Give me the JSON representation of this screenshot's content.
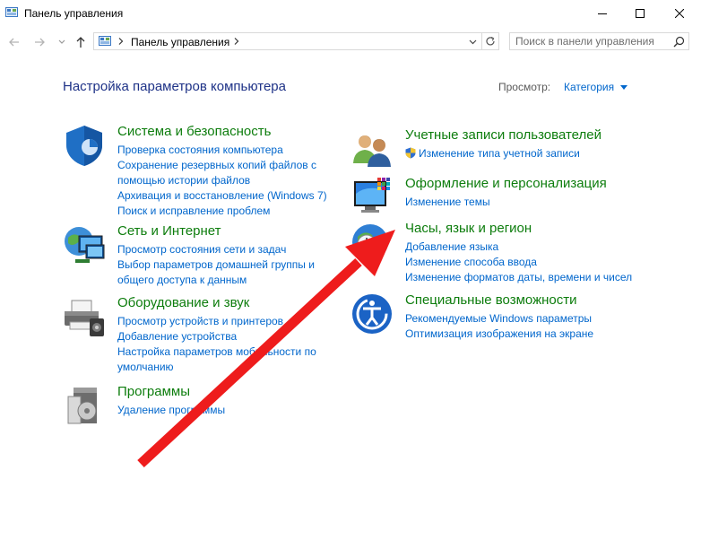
{
  "window": {
    "title": "Панель управления"
  },
  "nav": {
    "breadcrumb": "Панель управления",
    "search_placeholder": "Поиск в панели управления"
  },
  "header": {
    "heading": "Настройка параметров компьютера",
    "view_label": "Просмотр:",
    "view_value": "Категория"
  },
  "categories": [
    {
      "title": "Система и безопасность",
      "links": [
        "Проверка состояния компьютера",
        "Сохранение резервных копий файлов с",
        "помощью истории файлов",
        "Архивация и восстановление (Windows 7)",
        "Поиск и исправление проблем"
      ]
    },
    {
      "title": "Сеть и Интернет",
      "links": [
        "Просмотр состояния сети и задач",
        "Выбор параметров домашней группы и",
        "общего доступа к данным"
      ]
    },
    {
      "title": "Оборудование и звук",
      "links": [
        "Просмотр устройств и принтеров",
        "Добавление устройства",
        "Настройка параметров мобильности по",
        "умолчанию"
      ]
    },
    {
      "title": "Программы",
      "links": [
        "Удаление программы"
      ]
    },
    {
      "title": "Учетные записи пользователей",
      "links": [
        "Изменение типа учетной записи"
      ]
    },
    {
      "title": "Оформление и персонализация",
      "links": [
        "Изменение темы"
      ]
    },
    {
      "title": "Часы, язык и регион",
      "links": [
        "Добавление языка",
        "Изменение способа ввода",
        "Изменение форматов даты, времени и чисел"
      ]
    },
    {
      "title": "Специальные возможности",
      "links": [
        "Рекомендуемые Windows параметры",
        "Оптимизация изображения на экране"
      ]
    }
  ],
  "colors": {
    "heading": "#1e3287",
    "category_title": "#0d7d0d",
    "link": "#0066cc",
    "annotation_arrow": "#ee1c1c"
  }
}
